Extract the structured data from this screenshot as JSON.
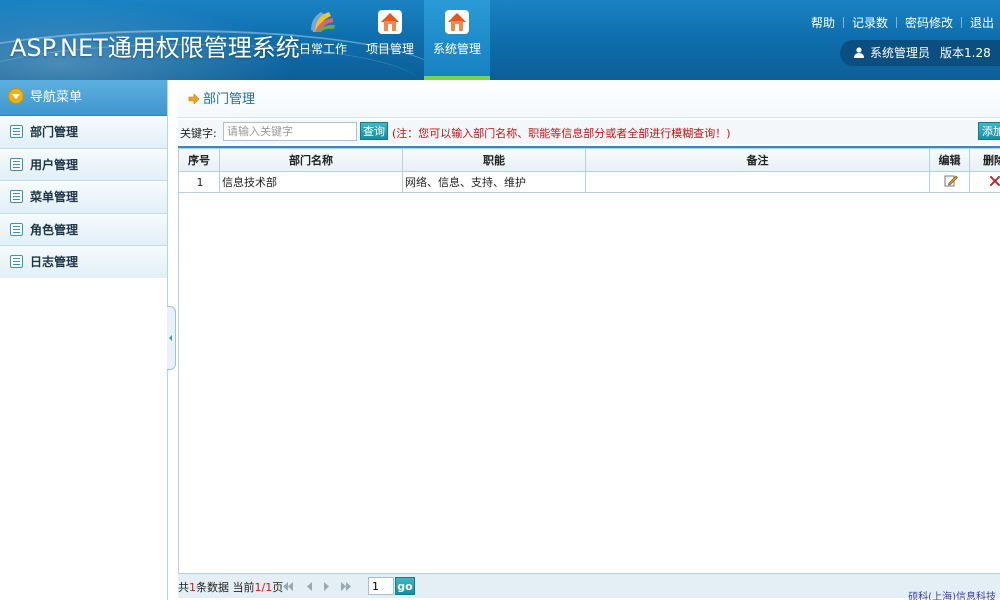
{
  "header": {
    "system_title": "ASP.NET通用权限管理系统",
    "tabs": [
      {
        "label": "日常工作",
        "icon": "color-fan-icon"
      },
      {
        "label": "项目管理",
        "icon": "house-icon"
      },
      {
        "label": "系统管理",
        "icon": "house-icon",
        "active": true
      }
    ],
    "links": [
      "帮助",
      "记录数",
      "密码修改",
      "退出"
    ],
    "user": "系统管理员",
    "version": "版本1.28"
  },
  "sidebar": {
    "title": "导航菜单",
    "items": [
      {
        "label": "部门管理"
      },
      {
        "label": "用户管理"
      },
      {
        "label": "菜单管理"
      },
      {
        "label": "角色管理"
      },
      {
        "label": "日志管理"
      }
    ]
  },
  "main": {
    "page_title": "部门管理",
    "search": {
      "label": "关键字:",
      "placeholder": "请输入关键字",
      "query_label": "查询",
      "hint": "(注：您可以输入部门名称、职能等信息部分或者全部进行模糊查询！)",
      "add_label": "添加"
    },
    "table": {
      "headers": [
        "序号",
        "部门名称",
        "职能",
        "备注",
        "编辑",
        "删除"
      ],
      "rows": [
        {
          "index": "1",
          "name": "信息技术部",
          "duty": "网络、信息、支持、维护",
          "remark": ""
        }
      ]
    },
    "pager": {
      "prefix": "共",
      "count": "1",
      "count_suffix": "条数据 当前",
      "current": "1/1",
      "page_suffix": "页",
      "page_value": "1",
      "go_label": "go",
      "company": "硕科(上海)信息科技"
    }
  },
  "colors": {
    "header_blue": "#0f6fae",
    "active_tab_underline": "#7fd04a",
    "hint_red": "#cc1111",
    "button_teal": "#178fa3"
  }
}
